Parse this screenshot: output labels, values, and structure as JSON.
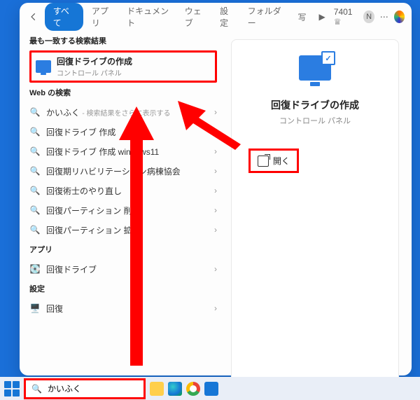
{
  "topbar": {
    "active_tab": "すべて",
    "tabs": [
      "アプリ",
      "ドキュメント",
      "ウェブ",
      "設定",
      "フォルダー",
      "写"
    ],
    "points": "7401",
    "avatar_initial": "N"
  },
  "left": {
    "best_header": "最も一致する検索結果",
    "best_title": "回復ドライブの作成",
    "best_sub": "コントロール パネル",
    "web_header": "Web の検索",
    "web_items": [
      {
        "label": "かいふく",
        "hint": "- 検索結果をさらに表示する"
      },
      {
        "label": "回復ドライブ 作成",
        "hint": ""
      },
      {
        "label": "回復ドライブ 作成 windows11",
        "hint": ""
      },
      {
        "label": "回復期リハビリテーション病棟協会",
        "hint": ""
      },
      {
        "label": "回復術士のやり直し",
        "hint": ""
      },
      {
        "label": "回復パーティション 削除",
        "hint": ""
      },
      {
        "label": "回復パーティション 拡張",
        "hint": ""
      }
    ],
    "apps_header": "アプリ",
    "apps_items": [
      {
        "label": "回復ドライブ"
      }
    ],
    "settings_header": "設定",
    "settings_items": [
      {
        "label": "回復"
      }
    ]
  },
  "preview": {
    "title": "回復ドライブの作成",
    "sub": "コントロール パネル",
    "open_label": "開く"
  },
  "taskbar": {
    "search_value": "かいふく"
  }
}
